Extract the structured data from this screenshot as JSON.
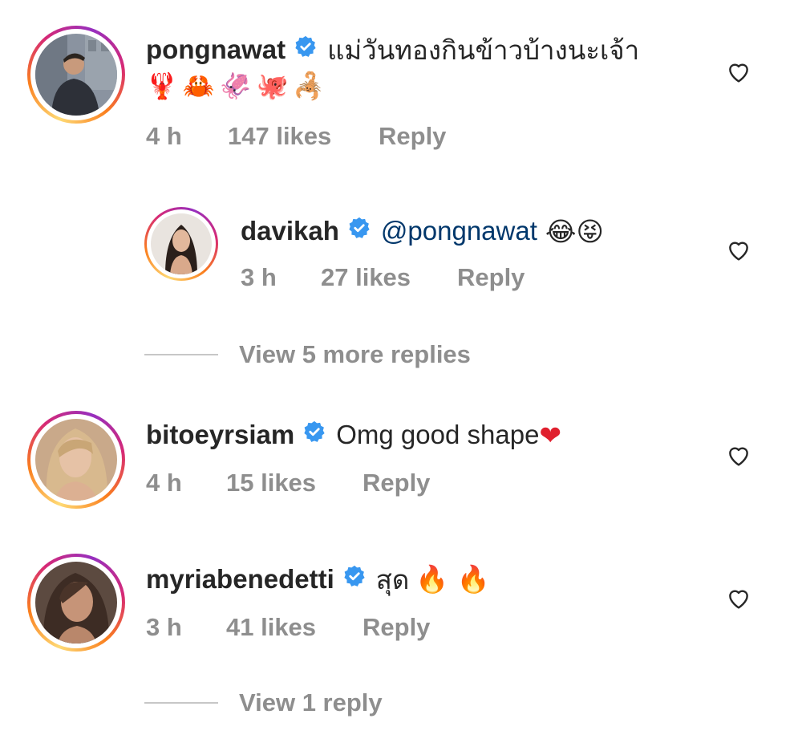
{
  "comments": [
    {
      "username": "pongnawat",
      "text": "แม่วันทองกินข้าวบ้างนะเจ้า",
      "emojis": "🦞🦀🦑🐙🦂",
      "time": "4 h",
      "likes": "147 likes",
      "reply_label": "Reply"
    },
    {
      "username": "davikah",
      "mention": "@pongnawat",
      "emojis": "😂😝",
      "time": "3 h",
      "likes": "27 likes",
      "reply_label": "Reply",
      "is_reply": true
    },
    {
      "username": "bitoeyrsiam",
      "text": "Omg good shape",
      "emojis": "❤",
      "time": "4 h",
      "likes": "15 likes",
      "reply_label": "Reply"
    },
    {
      "username": "myriabenedetti",
      "text": "สุด",
      "emojis": "🔥 🔥",
      "time": "3 h",
      "likes": "41 likes",
      "reply_label": "Reply"
    }
  ],
  "view_more_replies_1": "View 5 more replies",
  "view_more_replies_2": "View 1 reply",
  "icons": {
    "verified": "verified-badge-icon",
    "like": "heart-outline-icon"
  },
  "colors": {
    "username": "#262626",
    "meta": "#8e8e8e",
    "mention": "#00376b",
    "verified": "#3897f0"
  }
}
